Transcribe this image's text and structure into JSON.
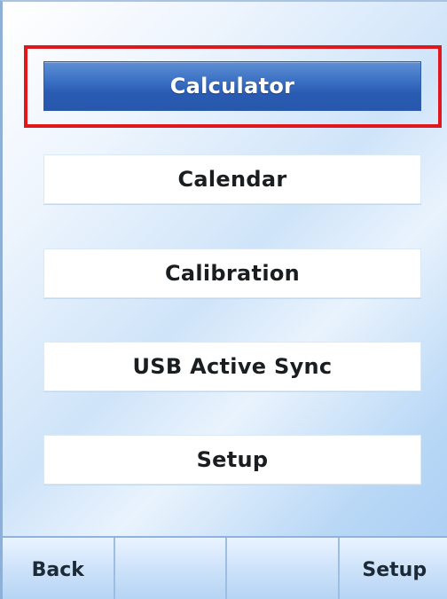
{
  "menu": {
    "items": [
      {
        "label": "Calculator",
        "selected": true
      },
      {
        "label": "Calendar",
        "selected": false
      },
      {
        "label": "Calibration",
        "selected": false
      },
      {
        "label": "USB Active Sync",
        "selected": false
      },
      {
        "label": "Setup",
        "selected": false
      }
    ]
  },
  "softkeys": {
    "left": "Back",
    "mid_left": "",
    "mid_right": "",
    "right": "Setup"
  },
  "colors": {
    "selected_fill": "#2f63b8",
    "focus_ring": "#e0181d",
    "background_light": "#ffffff",
    "background_blue": "#a7ccf3"
  }
}
